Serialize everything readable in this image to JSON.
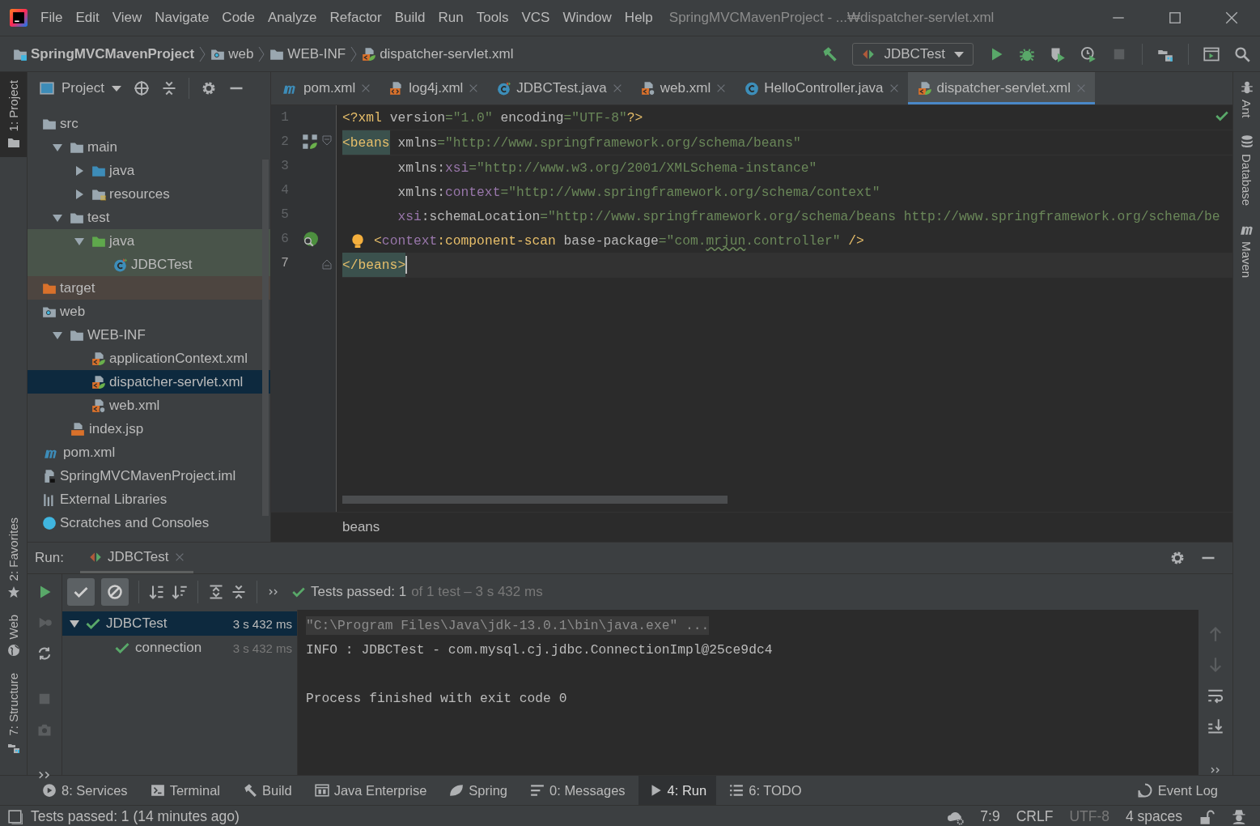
{
  "title_bar": {
    "menus": [
      "File",
      "Edit",
      "View",
      "Navigate",
      "Code",
      "Analyze",
      "Refactor",
      "Build",
      "Run",
      "Tools",
      "VCS",
      "Window",
      "Help"
    ],
    "title": "SpringMVCMavenProject - ...₩dispatcher-servlet.xml"
  },
  "breadcrumbs": [
    {
      "label": "SpringMVCMavenProject",
      "kind": "project"
    },
    {
      "label": "web",
      "kind": "web"
    },
    {
      "label": "WEB-INF",
      "kind": "folder"
    },
    {
      "label": "dispatcher-servlet.xml",
      "kind": "spring-xml"
    }
  ],
  "run_config": {
    "label": "JDBCTest"
  },
  "left_stripe": {
    "top": [
      {
        "label": "1: Project",
        "kind": "project",
        "selected": true
      }
    ],
    "bottom": [
      {
        "label": "2: Favorites",
        "kind": "favorites",
        "selected": false
      },
      {
        "label": "Web",
        "kind": "web",
        "selected": false
      },
      {
        "label": "7: Structure",
        "kind": "structure",
        "selected": false
      }
    ]
  },
  "right_stripe": [
    {
      "label": "Ant",
      "kind": "ant",
      "selected": false
    },
    {
      "label": "Database",
      "kind": "database",
      "selected": false
    },
    {
      "label": "Maven",
      "kind": "maven",
      "selected": false
    }
  ],
  "project_panel": {
    "title": "Project",
    "tree": [
      {
        "label": "src",
        "kind": "folder",
        "selected": false,
        "children": [
          {
            "label": "main",
            "kind": "folder",
            "expanded": true,
            "selected": false,
            "children": [
              {
                "label": "java",
                "kind": "source",
                "expanded": false,
                "selected": false
              },
              {
                "label": "resources",
                "kind": "resources",
                "expanded": false,
                "selected": false
              }
            ]
          },
          {
            "label": "test",
            "kind": "folder",
            "expanded": true,
            "selected": false,
            "children": [
              {
                "label": "java",
                "kind": "test-source",
                "expanded": true,
                "color": "#49544a",
                "selected": false,
                "children": [
                  {
                    "label": "JDBCTest",
                    "kind": "test-class",
                    "color": "#49544a",
                    "selected": false
                  }
                ]
              }
            ]
          }
        ]
      },
      {
        "label": "target",
        "kind": "excluded",
        "color": "#4d4540",
        "selected": false
      },
      {
        "label": "web",
        "kind": "web",
        "selected": false,
        "children": [
          {
            "label": "WEB-INF",
            "kind": "folder",
            "expanded": true,
            "selected": false,
            "children": [
              {
                "label": "applicationContext.xml",
                "kind": "spring-xml",
                "selected": false
              },
              {
                "label": "dispatcher-servlet.xml",
                "kind": "spring-xml",
                "selected": true
              },
              {
                "label": "web.xml",
                "kind": "web-xml",
                "selected": false
              }
            ]
          },
          {
            "label": "index.jsp",
            "kind": "jsp",
            "selected": false
          }
        ]
      },
      {
        "label": "pom.xml",
        "kind": "maven",
        "selected": false
      },
      {
        "label": "SpringMVCMavenProject.iml",
        "kind": "iml",
        "selected": false
      },
      {
        "label": "External Libraries",
        "kind": "libraries",
        "selected": false
      },
      {
        "label": "Scratches and Consoles",
        "kind": "scratches",
        "selected": false
      }
    ]
  },
  "editor_tabs": [
    {
      "label": "pom.xml",
      "kind": "maven",
      "selected": false
    },
    {
      "label": "log4j.xml",
      "kind": "xml",
      "selected": false
    },
    {
      "label": "JDBCTest.java",
      "kind": "test-class",
      "selected": false
    },
    {
      "label": "web.xml",
      "kind": "web-xml",
      "selected": false
    },
    {
      "label": "HelloController.java",
      "kind": "class",
      "selected": false
    },
    {
      "label": "dispatcher-servlet.xml",
      "kind": "spring-xml",
      "selected": true
    }
  ],
  "editor": {
    "lines": [
      {
        "number": "1",
        "kind": "top",
        "current": false,
        "tokens": [
          {
            "text": "<?xml",
            "kind": "tag"
          },
          {
            "text": " version",
            "kind": "attr"
          },
          {
            "text": "=\"1.0\"",
            "kind": "value"
          },
          {
            "text": " encoding",
            "kind": "attr"
          },
          {
            "text": "=\"UTF-8\"",
            "kind": "value"
          },
          {
            "text": "?>",
            "kind": "tag"
          }
        ]
      },
      {
        "number": "2",
        "kind": "top",
        "current": false,
        "gutter_icon": {
          "kind": "bean"
        },
        "fold": {
          "kind": "start"
        },
        "tokens": [
          {
            "text": "<beans",
            "kind": "tag-match"
          },
          {
            "text": " xmlns",
            "kind": "attr"
          },
          {
            "text": "=\"http://www.springframework.org/schema/beans\"",
            "kind": "value"
          }
        ]
      },
      {
        "number": "3",
        "kind": "continuation",
        "current": false,
        "tokens": [
          {
            "text": "xmlns:",
            "kind": "attr"
          },
          {
            "text": "xsi",
            "kind": "ns"
          },
          {
            "text": "=\"http://www.w3.org/2001/XMLSchema-instance\"",
            "kind": "value"
          }
        ]
      },
      {
        "number": "4",
        "kind": "continuation",
        "current": false,
        "tokens": [
          {
            "text": "xmlns:",
            "kind": "attr"
          },
          {
            "text": "context",
            "kind": "ns"
          },
          {
            "text": "=\"http://www.springframework.org/schema/context\"",
            "kind": "value"
          }
        ]
      },
      {
        "number": "5",
        "kind": "continuation",
        "current": false,
        "tokens": [
          {
            "text": "xsi",
            "kind": "ns"
          },
          {
            "text": ":schemaLocation",
            "kind": "attr"
          },
          {
            "text": "=\"http://www.springframework.org/schema/beans http://www.springframework.org/schema/be",
            "kind": "value"
          }
        ]
      },
      {
        "number": "6",
        "kind": "child",
        "current": false,
        "gutter_icon": {
          "kind": "spring-scan"
        },
        "bulb": true,
        "tokens": [
          {
            "text": "<",
            "kind": "tag"
          },
          {
            "text": "context",
            "kind": "ns"
          },
          {
            "text": ":component-scan",
            "kind": "tag"
          },
          {
            "text": " base-package",
            "kind": "attr"
          },
          {
            "text": "=\"com.",
            "kind": "value"
          },
          {
            "text": "mrjun",
            "kind": "typo"
          },
          {
            "text": ".controller\"",
            "kind": "value"
          },
          {
            "text": " />",
            "kind": "tag"
          }
        ]
      },
      {
        "number": "7",
        "kind": "top",
        "current": true,
        "fold": {
          "kind": "end"
        },
        "tokens": [
          {
            "text": "</beans>",
            "kind": "tag-match"
          }
        ]
      }
    ],
    "path": "beans"
  },
  "run_panel": {
    "label": "Run:",
    "tab": "JDBCTest",
    "filters": [
      {
        "kind": "passed",
        "selected": true
      },
      {
        "kind": "ignored",
        "selected": true
      }
    ],
    "summary": {
      "passed": "Tests passed: 1",
      "detail": "of 1 test – 3 s 432 ms"
    },
    "tests": [
      {
        "name": "JDBCTest",
        "time": "3 s 432 ms",
        "selected": true,
        "expanded": true,
        "children": [
          {
            "name": "connection",
            "time": "3 s 432 ms",
            "selected": false
          }
        ]
      }
    ],
    "console": [
      {
        "text": "\"C:\\Program Files\\Java\\jdk-13.0.1\\bin\\java.exe\" ...",
        "kind": "command"
      },
      {
        "text": "INFO : JDBCTest - com.mysql.cj.jdbc.ConnectionImpl@25ce9dc4",
        "kind": "output"
      },
      {
        "text": "Process finished with exit code 0",
        "kind": "exit"
      }
    ]
  },
  "tool_buttons": [
    {
      "label": "8: Services",
      "kind": "services",
      "selected": false
    },
    {
      "label": "Terminal",
      "kind": "terminal",
      "selected": false
    },
    {
      "label": "Build",
      "kind": "build",
      "selected": false
    },
    {
      "label": "Java Enterprise",
      "kind": "enterprise",
      "selected": false
    },
    {
      "label": "Spring",
      "kind": "spring",
      "selected": false
    },
    {
      "label": "0: Messages",
      "kind": "messages",
      "selected": false
    },
    {
      "label": "4: Run",
      "kind": "run",
      "selected": true
    },
    {
      "label": "6: TODO",
      "kind": "todo",
      "selected": false
    }
  ],
  "event_log": "Event Log",
  "status_bar": {
    "message": "Tests passed: 1 (14 minutes ago)",
    "position": "7:9",
    "line_separator": "CRLF",
    "encoding": "UTF-8",
    "indent": "4 spaces"
  }
}
